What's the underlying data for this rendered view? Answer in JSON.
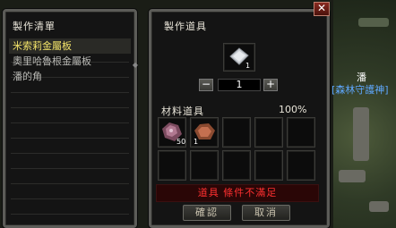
{
  "world": {
    "player_name": "潘",
    "guild_name": "[森林守護神]"
  },
  "list_panel": {
    "title": "製作清單",
    "items": [
      {
        "label": "米索莉金屬板",
        "selected": true
      },
      {
        "label": "奧里哈魯根金屬板",
        "selected": false
      },
      {
        "label": "潘的角",
        "selected": false
      }
    ]
  },
  "craft_panel": {
    "title": "製作道具",
    "product": {
      "icon": "metal-plate-icon",
      "count": "1"
    },
    "quantity": "1",
    "minus_label": "−",
    "plus_label": "+",
    "materials_title": "材料道具",
    "success_rate": "100%",
    "materials": [
      {
        "icon": "ore-purple-icon",
        "count": "50"
      },
      {
        "icon": "ore-orange-icon",
        "count": "1"
      }
    ],
    "warning": "道具 條件不滿足",
    "confirm_label": "確認",
    "cancel_label": "取消",
    "close_label": "✕"
  }
}
